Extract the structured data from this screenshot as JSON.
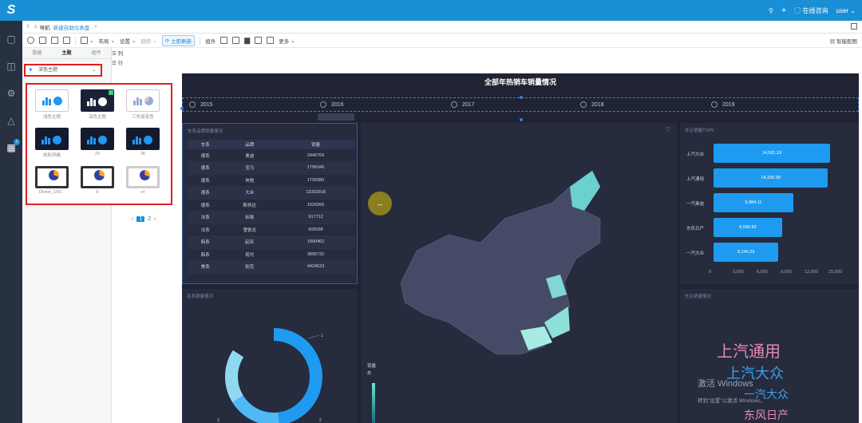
{
  "topbar": {
    "consult_label": "在线咨询",
    "user_label": "user"
  },
  "tabbar": {
    "nav_label": "导航",
    "tab_label": "新建自助仪表盘"
  },
  "toolbar": {
    "layout_label": "布局",
    "settings_label": "设置",
    "jump_label": "跳转",
    "refresh_label": "立即刷新",
    "component_label": "组件",
    "more_label": "更多",
    "smart_chart_label": "智能配图"
  },
  "leftpanel": {
    "tabs": [
      "数据",
      "主题",
      "组件"
    ],
    "col_label": "列",
    "row_label": "行",
    "theme_selected": "深色主题"
  },
  "themes": [
    {
      "label": "浅色主题"
    },
    {
      "label": "深色主题"
    },
    {
      "label": "三色渐变色"
    },
    {
      "label": "炫彩风格"
    },
    {
      "label": "23"
    },
    {
      "label": "36"
    },
    {
      "label": "Divine_150..."
    },
    {
      "label": "5"
    },
    {
      "label": "er"
    }
  ],
  "pager": {
    "page1": "1",
    "page2": "2"
  },
  "dashboard": {
    "title": "全部年热销车销量情况",
    "years": [
      "2015",
      "2016",
      "2017",
      "2018",
      "2019"
    ],
    "table_panel": {
      "title": "车系品牌销量情况",
      "headers": [
        "车系",
        "品牌",
        "销量"
      ],
      "rows": [
        [
          "德系",
          "奥迪",
          "2440769"
        ],
        [
          "德系",
          "宝马",
          "1795346"
        ],
        [
          "德系",
          "奔驰",
          "1799380"
        ],
        [
          "德系",
          "大众",
          "13333918"
        ],
        [
          "德系",
          "斯柯达",
          "1029266"
        ],
        [
          "法系",
          "标致",
          "917712"
        ],
        [
          "法系",
          "雪铁龙",
          "509038"
        ],
        [
          "韩系",
          "起亚",
          "1800462"
        ],
        [
          "韩系",
          "现代",
          "3895732"
        ],
        [
          "美系",
          "别克",
          "4424533"
        ]
      ]
    },
    "top5_panel": {
      "title": "车企销量TOP5"
    },
    "donut_panel": {
      "title": "各系销量情况"
    },
    "wordcloud_panel": {
      "title": "车企销量情况"
    },
    "map_legend_title": "销量",
    "map_legend_label": "高",
    "donut_labels": [
      "1",
      "2",
      "3"
    ]
  },
  "chart_data": {
    "type": "bar",
    "orientation": "horizontal",
    "categories": [
      "上汽大众",
      "上汽通用",
      "一汽奥迪",
      "东风日产",
      "一汽大众"
    ],
    "values": [
      14581.19,
      14330.98,
      9984.11,
      8596.82,
      8146.29
    ],
    "value_labels": [
      "14,581.19",
      "14,330.98",
      "9,984.11",
      "8,596.82",
      "8,146.29"
    ],
    "xlim": [
      0,
      15000
    ],
    "xticks": [
      "0",
      "3,000",
      "6,000",
      "9,000",
      "12,000",
      "15,000"
    ]
  },
  "wordcloud": {
    "words": [
      "上汽通用",
      "上汽大众",
      "一汽大众",
      "东风日产"
    ]
  },
  "watermark": {
    "line1": "激活 Windows",
    "line2": "转到\"设置\"以激活 Windows。"
  },
  "colors": {
    "topbar": "#1a8fd6",
    "canvas_bg": "#1f2333",
    "bar": "#1e9bf0",
    "highlight_border": "#e02020"
  }
}
